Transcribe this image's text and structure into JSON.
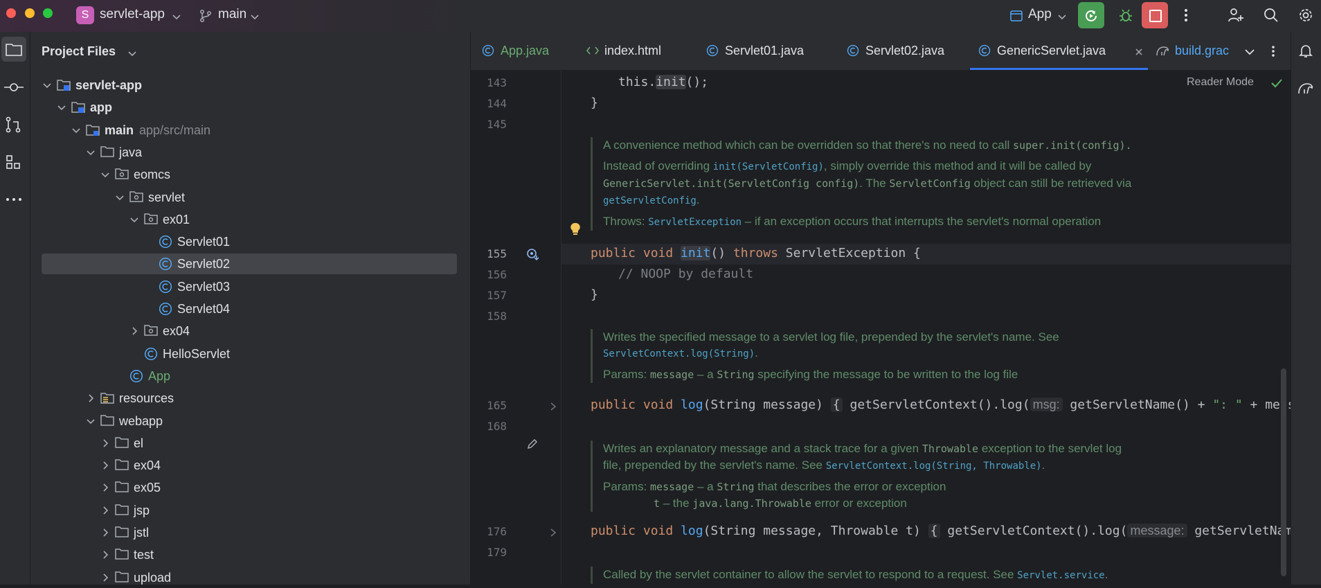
{
  "titlebar": {
    "project_badge": "S",
    "project_name": "servlet-app",
    "branch": "main",
    "run_config": "App"
  },
  "project_panel": {
    "title": "Project Files",
    "tree": [
      {
        "label": "servlet-app",
        "sub": "",
        "depth": 0,
        "kind": "module",
        "expanded": true,
        "bold": true
      },
      {
        "label": "app",
        "sub": "",
        "depth": 1,
        "kind": "module",
        "expanded": true,
        "bold": true
      },
      {
        "label": "main",
        "sub": "app/src/main",
        "depth": 2,
        "kind": "source-folder",
        "expanded": true,
        "bold": true
      },
      {
        "label": "java",
        "sub": "",
        "depth": 3,
        "kind": "folder",
        "expanded": true
      },
      {
        "label": "eomcs",
        "sub": "",
        "depth": 4,
        "kind": "package",
        "expanded": true
      },
      {
        "label": "servlet",
        "sub": "",
        "depth": 5,
        "kind": "package",
        "expanded": true
      },
      {
        "label": "ex01",
        "sub": "",
        "depth": 6,
        "kind": "package",
        "expanded": true
      },
      {
        "label": "Servlet01",
        "sub": "",
        "depth": 7,
        "kind": "class"
      },
      {
        "label": "Servlet02",
        "sub": "",
        "depth": 7,
        "kind": "class",
        "selected": true
      },
      {
        "label": "Servlet03",
        "sub": "",
        "depth": 7,
        "kind": "class"
      },
      {
        "label": "Servlet04",
        "sub": "",
        "depth": 7,
        "kind": "class"
      },
      {
        "label": "ex04",
        "sub": "",
        "depth": 6,
        "kind": "package",
        "expanded": false
      },
      {
        "label": "HelloServlet",
        "sub": "",
        "depth": 6,
        "kind": "class"
      },
      {
        "label": "App",
        "sub": "",
        "depth": 5,
        "kind": "class",
        "green": true
      },
      {
        "label": "resources",
        "sub": "",
        "depth": 3,
        "kind": "resources",
        "expanded": false
      },
      {
        "label": "webapp",
        "sub": "",
        "depth": 3,
        "kind": "folder",
        "expanded": true
      },
      {
        "label": "el",
        "sub": "",
        "depth": 4,
        "kind": "folder",
        "expanded": false
      },
      {
        "label": "ex04",
        "sub": "",
        "depth": 4,
        "kind": "folder",
        "expanded": false
      },
      {
        "label": "ex05",
        "sub": "",
        "depth": 4,
        "kind": "folder",
        "expanded": false
      },
      {
        "label": "jsp",
        "sub": "",
        "depth": 4,
        "kind": "folder",
        "expanded": false
      },
      {
        "label": "jstl",
        "sub": "",
        "depth": 4,
        "kind": "folder",
        "expanded": false
      },
      {
        "label": "test",
        "sub": "",
        "depth": 4,
        "kind": "folder",
        "expanded": false
      },
      {
        "label": "upload",
        "sub": "",
        "depth": 4,
        "kind": "folder",
        "expanded": false
      }
    ]
  },
  "tabs": [
    {
      "label": "App.java",
      "kind": "class",
      "color": "#6aab73"
    },
    {
      "label": "index.html",
      "kind": "html",
      "color": "#dfe1e5"
    },
    {
      "label": "Servlet01.java",
      "kind": "class",
      "color": "#dfe1e5"
    },
    {
      "label": "Servlet02.java",
      "kind": "class",
      "color": "#dfe1e5"
    },
    {
      "label": "GenericServlet.java",
      "kind": "class",
      "color": "#dfe1e5",
      "active": true,
      "closable": true
    },
    {
      "label": "build.grac",
      "kind": "gradle",
      "color": "#56a8f5"
    }
  ],
  "editor": {
    "reader_mode": "Reader Mode",
    "line_numbers": {
      "l143": "143",
      "l144": "144",
      "l145": "145",
      "l155": "155",
      "l156": "156",
      "l157": "157",
      "l158": "158",
      "l165": "165",
      "l168": "168",
      "l176": "176",
      "l179": "179"
    },
    "code": {
      "c143_this": "this.",
      "c143_init": "init",
      "c143_end": "();",
      "c144": "}",
      "c155_kw": "public void ",
      "c155_fn": "init",
      "c155_mid": "() ",
      "c155_throws": "throws",
      "c155_end": " ServletException {",
      "c156": "// NOOP by default",
      "c157": "}",
      "c165_kw": "public void ",
      "c165_fn": "log",
      "c165_params": "(String message) ",
      "c165_fold": "{",
      "c165_call": " getServletContext().log(",
      "c165_hint": "msg:",
      "c165_args": " getServletName() + ",
      "c165_str": "\": \"",
      "c165_end": " + message);",
      "c176_kw": "public void ",
      "c176_fn": "log",
      "c176_params": "(String message, Throwable t) ",
      "c176_fold": "{",
      "c176_call": " getServletContext().log(",
      "c176_hint": "message:",
      "c176_args": " getServletName() + '"
    },
    "doc1": {
      "line1_text": "A convenience method which can be overridden so that there's no need to call ",
      "line1_code": "super.init(config).",
      "line2_a": "Instead of overriding ",
      "line2_link": "init(ServletConfig)",
      "line2_b": ", simply override this method and it will be called by",
      "line3_code1": "GenericServlet.init(ServletConfig config)",
      "line3_b": ". The ",
      "line3_code2": "ServletConfig",
      "line3_c": " object can still be retrieved via",
      "line4_link": "getServletConfig",
      "line4_b": ".",
      "throws_label": "Throws: ",
      "throws_link": "ServletException",
      "throws_text": " – if an exception occurs that interrupts the servlet's normal operation"
    },
    "doc2": {
      "line1": "Writes the specified message to a servlet log file, prepended by the servlet's name. See",
      "line2_link": "ServletContext.log(String)",
      "line2_b": ".",
      "params_label": "Params: ",
      "params_code": "message",
      "params_a": " – a ",
      "params_code2": "String",
      "params_b": " specifying the message to be written to the log file"
    },
    "doc3": {
      "line1_a": "Writes an explanatory message and a stack trace for a given ",
      "line1_code": "Throwable",
      "line1_b": " exception to the servlet log",
      "line2_a": "file, prepended by the servlet's name. See ",
      "line2_link": "ServletContext.log(String, Throwable)",
      "line2_b": ".",
      "params_label": "Params: ",
      "p1_code": "message",
      "p1_a": " – a ",
      "p1_code2": "String",
      "p1_b": " that describes the error or exception",
      "p2_code": "t",
      "p2_a": " – the ",
      "p2_code2": "java.lang.Throwable",
      "p2_b": " error or exception"
    },
    "doc4": {
      "line1_a": "Called by the servlet container to allow the servlet to respond to a request. See ",
      "line1_link": "Servlet.service",
      "line1_b": "."
    }
  }
}
